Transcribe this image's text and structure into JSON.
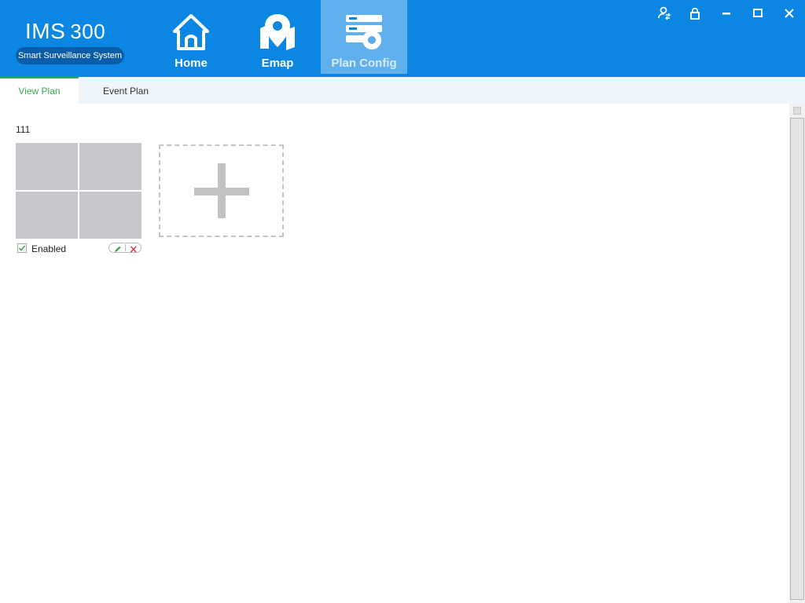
{
  "app": {
    "logo_title": "IMS",
    "logo_number": "300",
    "logo_subtitle": "Smart Surveillance System"
  },
  "nav": {
    "tabs": [
      {
        "label": "Home",
        "icon": "home-icon",
        "active": false
      },
      {
        "label": "Emap",
        "icon": "map-pin-icon",
        "active": false
      },
      {
        "label": "Plan Config",
        "icon": "plan-config-icon",
        "active": true
      }
    ]
  },
  "window_controls": {
    "icons": [
      "user-switch-icon",
      "lock-icon",
      "minimize-icon",
      "maximize-icon",
      "close-icon"
    ]
  },
  "subtabs": {
    "items": [
      {
        "label": "View Plan",
        "active": true
      },
      {
        "label": "Event Plan",
        "active": false
      }
    ]
  },
  "plans": [
    {
      "name": "111",
      "enabled_label": "Enabled",
      "enabled": true,
      "layout": "2x2"
    }
  ],
  "colors": {
    "header_bg": "#0b86e3",
    "active_subtab": "#3aa74f",
    "edit_icon": "#2e9b3b",
    "delete_icon": "#e0393e"
  }
}
